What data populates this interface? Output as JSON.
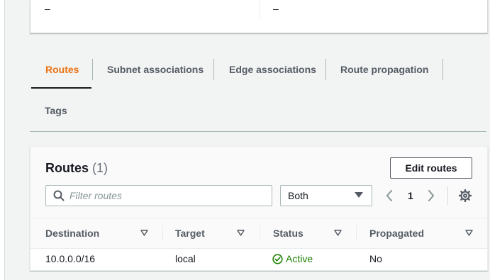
{
  "top_card": {
    "left_value": "–",
    "right_value": "–"
  },
  "tabs": [
    {
      "label": "Routes",
      "active": true
    },
    {
      "label": "Subnet associations",
      "active": false
    },
    {
      "label": "Edge associations",
      "active": false
    },
    {
      "label": "Route propagation",
      "active": false
    },
    {
      "label": "Tags",
      "active": false
    }
  ],
  "routes_panel": {
    "title": "Routes",
    "count": "(1)",
    "edit_button": "Edit routes",
    "filter_placeholder": "Filter routes",
    "filter_value": "",
    "select_value": "Both",
    "page_number": "1",
    "columns": [
      "Destination",
      "Target",
      "Status",
      "Propagated"
    ],
    "rows": [
      {
        "destination": "10.0.0.0/16",
        "target": "local",
        "status": "Active",
        "propagated": "No"
      }
    ]
  },
  "colors": {
    "accent": "#ec7211",
    "status_active": "#1d8102",
    "text": "#16191f",
    "muted": "#545b64"
  },
  "icons": {
    "filter": "search-icon",
    "select": "caret-down-icon",
    "prev": "chevron-left-icon",
    "next": "chevron-right-icon",
    "settings": "gear-icon",
    "sort": "sort-caret-icon",
    "status": "check-circle-icon"
  }
}
